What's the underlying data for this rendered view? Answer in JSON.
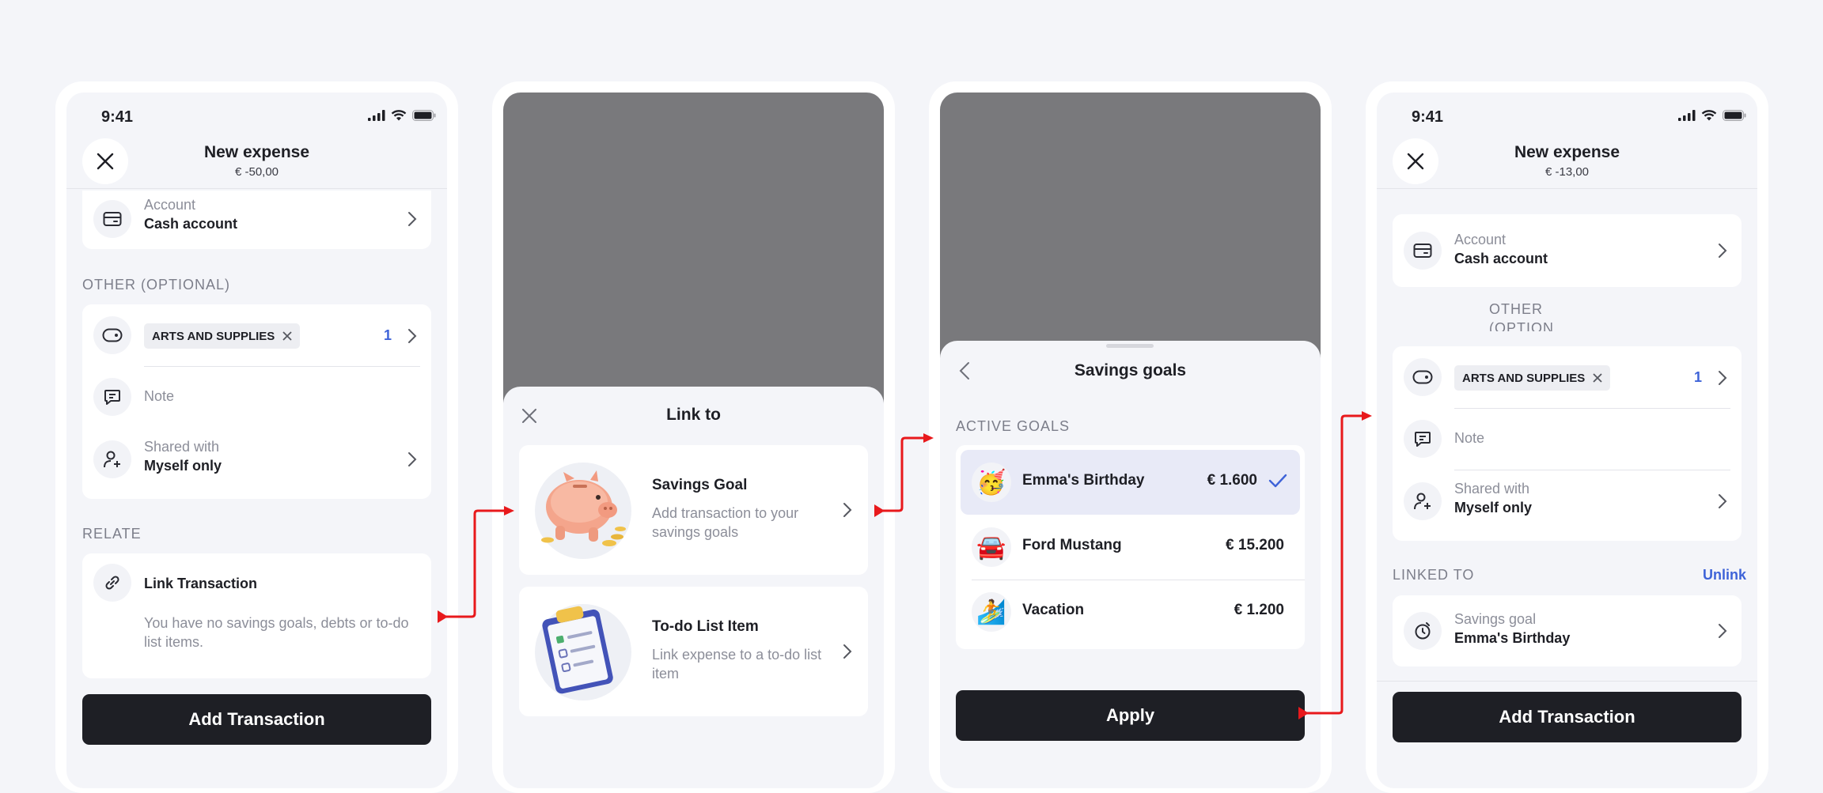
{
  "status": {
    "time": "9:41"
  },
  "screen1": {
    "title": "New expense",
    "amount": "€ -50,00",
    "account_label": "Account",
    "account_value": "Cash account",
    "other_section": "OTHER (OPTIONAL)",
    "category_chip": "ARTS AND SUPPLIES",
    "category_count": "1",
    "note_placeholder": "Note",
    "shared_label": "Shared with",
    "shared_value": "Myself only",
    "relate_section": "RELATE",
    "link_title": "Link Transaction",
    "link_desc": "You have no savings goals, debts or to-do list items.",
    "button": "Add Transaction"
  },
  "screen2": {
    "sheet_title": "Link to",
    "options": [
      {
        "title": "Savings Goal",
        "desc": "Add transaction to your savings goals",
        "icon": "piggy-bank-icon"
      },
      {
        "title": "To-do List Item",
        "desc": "Link expense to a to-do list item",
        "icon": "clipboard-icon"
      }
    ]
  },
  "screen3": {
    "sheet_title": "Savings goals",
    "section": "ACTIVE GOALS",
    "goals": [
      {
        "name": "Emma's Birthday",
        "amount": "€ 1.600",
        "emoji": "🥳",
        "selected": true
      },
      {
        "name": "Ford Mustang",
        "amount": "€ 15.200",
        "emoji": "🚘",
        "selected": false
      },
      {
        "name": "Vacation",
        "amount": "€ 1.200",
        "emoji": "🏄",
        "selected": false
      }
    ],
    "button": "Apply"
  },
  "screen4": {
    "title": "New expense",
    "amount": "€ -13,00",
    "account_label": "Account",
    "account_value": "Cash account",
    "other_section": "OTHER (OPTION AL)",
    "category_chip": "ARTS AND SUPPLIES",
    "category_count": "1",
    "note_placeholder": "Note",
    "shared_label": "Shared with",
    "shared_value": "Myself only",
    "linked_section": "LINKED TO",
    "unlink": "Unlink",
    "linked_label": "Savings goal",
    "linked_value": "Emma's Birthday",
    "button": "Add Transaction"
  },
  "colors": {
    "accent": "#3e63d8",
    "arrow": "#e8191c",
    "dark": "#1e1f25",
    "overlay": "#79797c"
  }
}
